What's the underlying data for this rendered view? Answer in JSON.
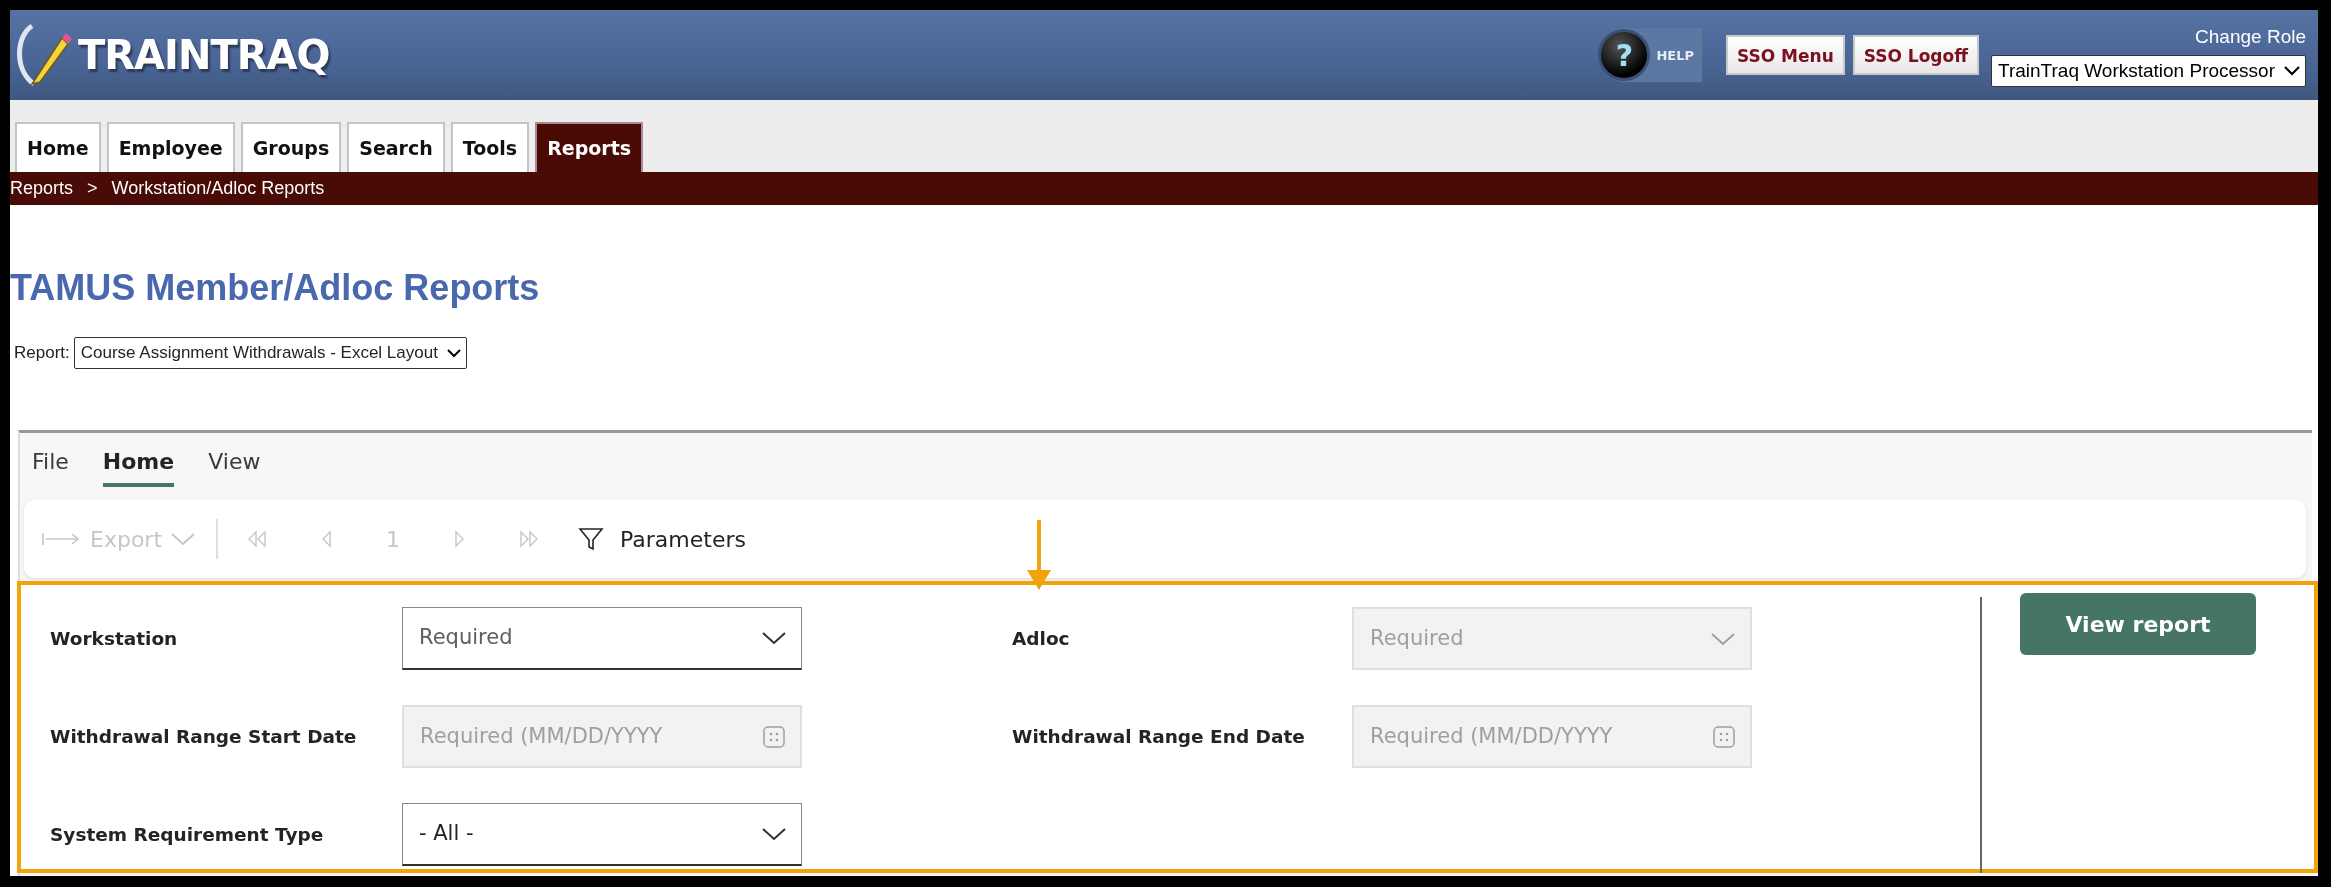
{
  "header": {
    "logo": "TRAINTRAQ",
    "help": {
      "glyph": "?",
      "label": "HELP"
    },
    "buttons": [
      "SSO Menu",
      "SSO Logoff"
    ],
    "change_role": "Change Role",
    "role_select": {
      "value": "TrainTraq Workstation Processor"
    }
  },
  "tabs": [
    {
      "label": "Home",
      "selected": false
    },
    {
      "label": "Employee",
      "selected": false
    },
    {
      "label": "Groups",
      "selected": false
    },
    {
      "label": "Search",
      "selected": false
    },
    {
      "label": "Tools",
      "selected": false
    },
    {
      "label": "Reports",
      "selected": true
    }
  ],
  "breadcrumb": {
    "items": [
      "Reports",
      "Workstation/Adloc Reports"
    ],
    "separator": ">"
  },
  "title": "TAMUS Member/Adloc Reports",
  "report_select": {
    "label": "Report:",
    "value": "Course Assignment Withdrawals - Excel Layout"
  },
  "viewer": {
    "menu_tabs": [
      {
        "label": "File",
        "selected": false
      },
      {
        "label": "Home",
        "selected": true
      },
      {
        "label": "View",
        "selected": false
      }
    ],
    "toolbar": {
      "export": {
        "label": "Export",
        "disabled": true
      },
      "page": "1",
      "parameters": "Parameters"
    },
    "parameters": [
      {
        "label": "Workstation",
        "kind": "dropdown",
        "placeholder": "Required",
        "disabled": false
      },
      {
        "label": "Adloc",
        "kind": "dropdown",
        "placeholder": "Required",
        "disabled": true
      },
      {
        "label": "Withdrawal Range Start Date",
        "kind": "date",
        "placeholder": "Required (MM/DD/YYYY",
        "disabled": true
      },
      {
        "label": "Withdrawal Range End Date",
        "kind": "date",
        "placeholder": "Required (MM/DD/YYYY",
        "disabled": true
      },
      {
        "label": "System Requirement Type",
        "kind": "dropdown",
        "value": "- All -",
        "disabled": false
      }
    ],
    "view_button": "View report"
  }
}
